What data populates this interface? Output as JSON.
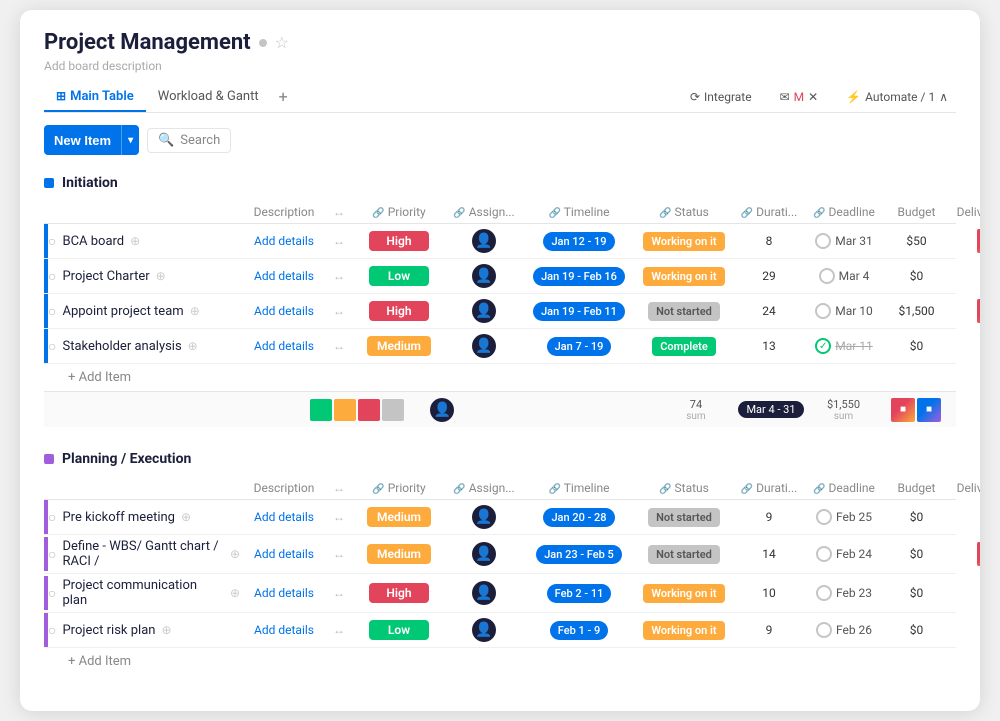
{
  "header": {
    "title": "Project Management",
    "add_desc": "Add board description",
    "star_icon": "☆",
    "dot_icon": "●"
  },
  "tabs": {
    "items": [
      {
        "label": "Main Table",
        "active": true
      },
      {
        "label": "Workload & Gantt",
        "active": false
      }
    ],
    "add_label": "+",
    "integrate_label": "Integrate",
    "automate_label": "Automate / 1"
  },
  "toolbar": {
    "new_item_label": "New Item",
    "new_item_arrow": "▾",
    "search_label": "Search"
  },
  "groups": [
    {
      "id": "initiation",
      "color": "#0073ea",
      "title": "Initiation",
      "columns": [
        "Description",
        "↔",
        "Priority",
        "Assign...",
        "Timeline",
        "Status",
        "Durati...",
        "Deadline",
        "Budget",
        "Deliverables"
      ],
      "rows": [
        {
          "name": "BCA board",
          "desc": "Add details",
          "priority": "High",
          "priority_color": "high",
          "timeline": "Jan 12 - 19",
          "status": "Working on it",
          "status_color": "working",
          "duration": "8",
          "deadline": "Mar 31",
          "budget": "$50",
          "has_deliverable": true,
          "bar_color": "#0073ea"
        },
        {
          "name": "Project Charter",
          "desc": "Add details",
          "priority": "Low",
          "priority_color": "low",
          "timeline": "Jan 19 - Feb 16",
          "status": "Working on it",
          "status_color": "working",
          "duration": "29",
          "deadline": "Mar 4",
          "budget": "$0",
          "has_deliverable": false,
          "bar_color": "#0073ea"
        },
        {
          "name": "Appoint project team",
          "desc": "Add details",
          "priority": "High",
          "priority_color": "high",
          "timeline": "Jan 19 - Feb 11",
          "status": "Not started",
          "status_color": "notstarted",
          "duration": "24",
          "deadline": "Mar 10",
          "budget": "$1,500",
          "has_deliverable": true,
          "bar_color": "#0073ea"
        },
        {
          "name": "Stakeholder analysis",
          "desc": "Add details",
          "priority": "Medium",
          "priority_color": "medium",
          "timeline": "Jan 7 - 19",
          "status": "Complete",
          "status_color": "complete",
          "duration": "13",
          "deadline": "Mar 11",
          "deadline_done": true,
          "budget": "$0",
          "has_deliverable": false,
          "bar_color": "#0073ea"
        }
      ],
      "summary": {
        "colors": [
          "#00c875",
          "#fdab3d",
          "#e2445c",
          "#c4c4c4"
        ],
        "duration_sum": "74",
        "duration_label": "sum",
        "deadline_range": "Mar 4 - 31",
        "budget_sum": "$1,550",
        "budget_label": "sum"
      },
      "add_item_label": "+ Add Item"
    },
    {
      "id": "planning-execution",
      "color": "#a25ddc",
      "title": "Planning / Execution",
      "columns": [
        "Description",
        "↔",
        "Priority",
        "Assign...",
        "Timeline",
        "Status",
        "Durati...",
        "Deadline",
        "Budget",
        "Deliverables"
      ],
      "rows": [
        {
          "name": "Pre kickoff meeting",
          "desc": "Add details",
          "priority": "Medium",
          "priority_color": "medium",
          "timeline": "Jan 20 - 28",
          "status": "Not started",
          "status_color": "notstarted",
          "duration": "9",
          "deadline": "Feb 25",
          "budget": "$0",
          "has_deliverable": false,
          "bar_color": "#a25ddc"
        },
        {
          "name": "Define - WBS/ Gantt chart / RACI /",
          "desc": "Add details",
          "priority": "Medium",
          "priority_color": "medium",
          "timeline": "Jan 23 - Feb 5",
          "status": "Not started",
          "status_color": "notstarted",
          "duration": "14",
          "deadline": "Feb 24",
          "budget": "$0",
          "has_deliverable": true,
          "bar_color": "#a25ddc"
        },
        {
          "name": "Project communication plan",
          "desc": "Add details",
          "priority": "High",
          "priority_color": "high",
          "timeline": "Feb 2 - 11",
          "status": "Working on it",
          "status_color": "working",
          "duration": "10",
          "deadline": "Feb 23",
          "budget": "$0",
          "has_deliverable": false,
          "bar_color": "#a25ddc"
        },
        {
          "name": "Project risk plan",
          "desc": "Add details",
          "priority": "Low",
          "priority_color": "low",
          "timeline": "Feb 1 - 9",
          "status": "Working on it",
          "status_color": "working",
          "duration": "9",
          "deadline": "Feb 26",
          "budget": "$0",
          "has_deliverable": false,
          "bar_color": "#a25ddc"
        }
      ],
      "add_item_label": "+ Add Item"
    }
  ]
}
